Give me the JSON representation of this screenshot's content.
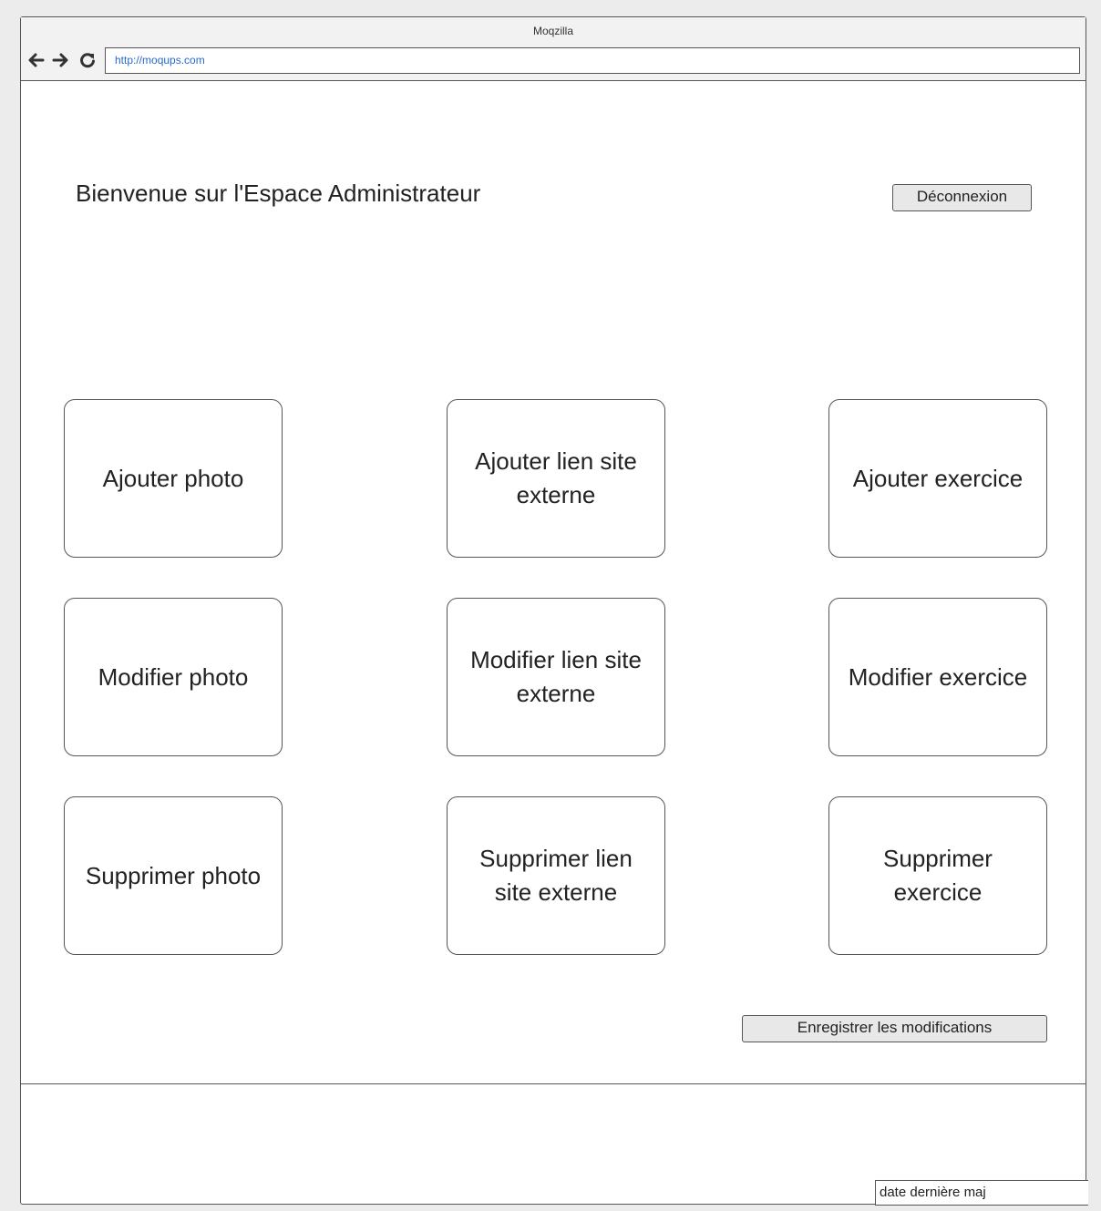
{
  "browser": {
    "window_title": "Moqzilla",
    "url": "http://moqups.com",
    "nav_icons": [
      "back-arrow-icon",
      "forward-arrow-icon",
      "reload-icon"
    ]
  },
  "header": {
    "title": "Bienvenue sur l'Espace Administrateur",
    "logout_label": "Déconnexion"
  },
  "tiles": [
    {
      "label": "Ajouter photo"
    },
    {
      "label": "Ajouter lien site externe"
    },
    {
      "label": "Ajouter exercice"
    },
    {
      "label": "Modifier photo"
    },
    {
      "label": "Modifier lien site externe"
    },
    {
      "label": "Modifier exercice"
    },
    {
      "label": "Supprimer photo"
    },
    {
      "label": "Supprimer lien site externe"
    },
    {
      "label": "Supprimer exercice"
    }
  ],
  "actions": {
    "save_label": "Enregistrer les modifications"
  },
  "footer": {
    "last_update_label": "date dernière maj"
  }
}
